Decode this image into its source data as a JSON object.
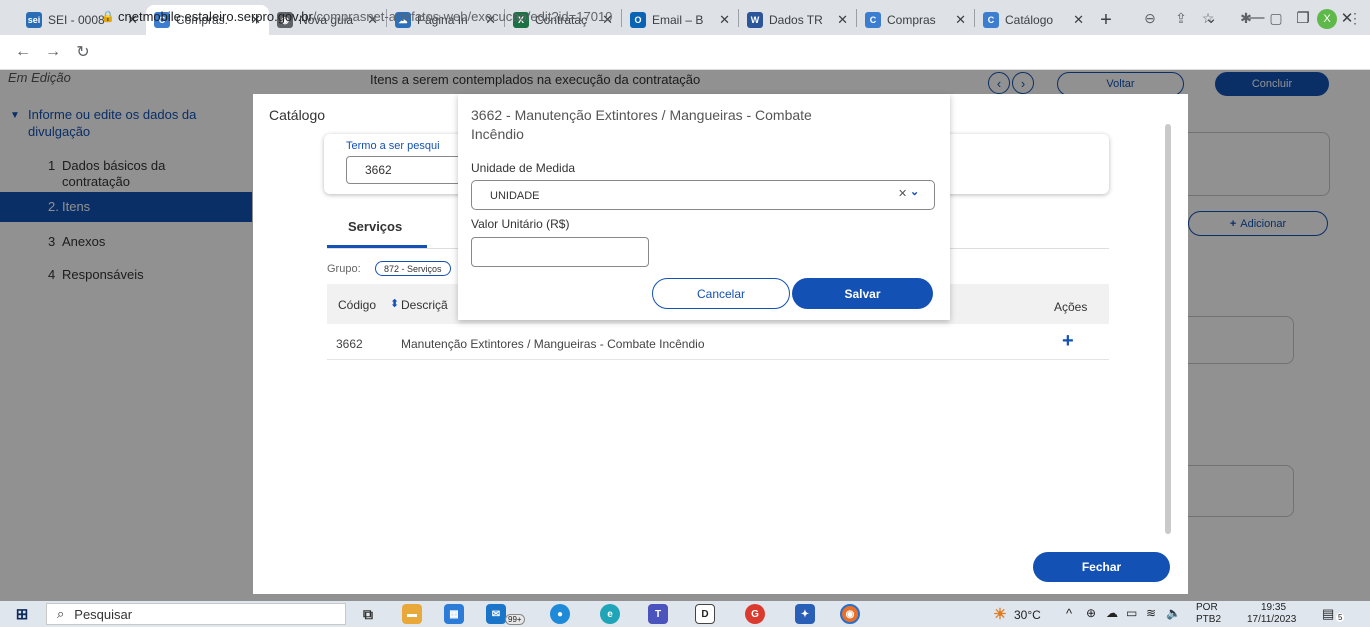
{
  "browser": {
    "tabs": [
      {
        "label": "SEI - 0008",
        "icon": "sei-icon",
        "color": "#2a6db5",
        "glyph": "sei",
        "active": false
      },
      {
        "label": "Compras.",
        "icon": "compras-icon",
        "color": "#3c7dd0",
        "glyph": "C",
        "active": true
      },
      {
        "label": "Nova guia",
        "icon": "chrome-icon",
        "color": "#5f6368",
        "glyph": "◉",
        "active": false
      },
      {
        "label": "Página In",
        "icon": "cloud-icon",
        "color": "#2d6fb8",
        "glyph": "☁",
        "active": false
      },
      {
        "label": "Contrataç",
        "icon": "excel-icon",
        "color": "#1e7145",
        "glyph": "X",
        "active": false
      },
      {
        "label": "Email – B",
        "icon": "outlook-icon",
        "color": "#0a64b3",
        "glyph": "O",
        "active": false
      },
      {
        "label": "Dados TR",
        "icon": "word-icon",
        "color": "#2b579a",
        "glyph": "W",
        "active": false
      },
      {
        "label": "Compras",
        "icon": "compras-icon",
        "color": "#3c7dd0",
        "glyph": "C",
        "active": false
      },
      {
        "label": "Catálogo",
        "icon": "compras-icon",
        "color": "#3c7dd0",
        "glyph": "C",
        "active": false
      }
    ],
    "new_tab": "+",
    "url_host": "cnetmobile.estaleiro.serpro.gov.br",
    "url_path": "/comprasnet-artefatos-web/execucao/edit?id=17010",
    "profile_initial": "X"
  },
  "page": {
    "status": "Em Edição",
    "header_text": "Itens a serem contemplados na execução da contratação",
    "voltar": "Voltar",
    "concluir": "Concluir",
    "adicionar": "Adicionar",
    "sidebar": {
      "group": "Informe ou edite os dados da divulgação",
      "items": [
        {
          "num": "1",
          "label": "Dados básicos da contratação",
          "active": false
        },
        {
          "num": "2.",
          "label": "Itens",
          "active": true
        },
        {
          "num": "3",
          "label": "Anexos",
          "active": false
        },
        {
          "num": "4",
          "label": "Responsáveis",
          "active": false
        }
      ]
    }
  },
  "catalog": {
    "title": "Catálogo",
    "search_label": "Termo a ser pesqui",
    "search_value": "3662",
    "tab": "Serviços",
    "grupo_label": "Grupo:",
    "grupo_value": "872 - Serviços",
    "col_code": "Código",
    "col_desc": "Descriçã",
    "col_actions": "Ações",
    "rows": [
      {
        "code": "3662",
        "desc": "Manutenção Extintores / Mangueiras - Combate Incêndio"
      }
    ],
    "close_button": "Fechar"
  },
  "dialog": {
    "title": "3662 - Manutenção Extintores / Mangueiras - Combate Incêndio",
    "unit_label": "Unidade de Medida",
    "unit_value": "UNIDADE",
    "price_label": "Valor Unitário (R$)",
    "price_value": "",
    "cancel": "Cancelar",
    "save": "Salvar"
  },
  "taskbar": {
    "search_placeholder": "Pesquisar",
    "badge_count": "99+",
    "temperature": "30°C",
    "language": "POR",
    "language_sub": "PTB2",
    "time": "19:35",
    "date": "17/11/2023",
    "notification_count": "5"
  },
  "colors": {
    "accent": "#1351b4",
    "overlay": "rgba(0,0,0,0.43)"
  }
}
